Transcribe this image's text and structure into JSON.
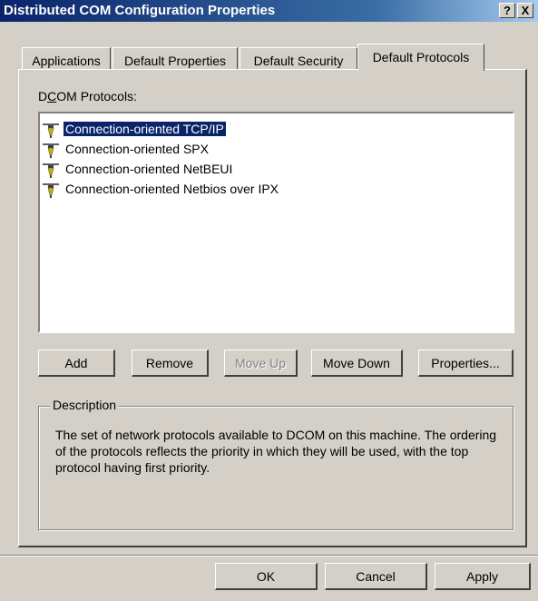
{
  "window": {
    "title": "Distributed COM Configuration Properties",
    "help_btn": "?",
    "close_btn": "X"
  },
  "tabs": [
    {
      "label": "Applications"
    },
    {
      "label": "Default Properties"
    },
    {
      "label": "Default Security"
    },
    {
      "label": "Default Protocols",
      "active": true
    }
  ],
  "protocols_label": "DCOM Protocols:",
  "protocols": [
    {
      "label": "Connection-oriented TCP/IP",
      "selected": true
    },
    {
      "label": "Connection-oriented SPX"
    },
    {
      "label": "Connection-oriented NetBEUI"
    },
    {
      "label": "Connection-oriented Netbios over IPX"
    }
  ],
  "buttons": {
    "add": "Add",
    "remove": "Remove",
    "move_up": "Move Up",
    "move_down": "Move Down",
    "properties": "Properties..."
  },
  "description": {
    "title": "Description",
    "text": "The set of network protocols available to DCOM on this machine. The ordering of the protocols reflects the priority in which they will be used, with the top protocol having first priority."
  },
  "footer": {
    "ok": "OK",
    "cancel": "Cancel",
    "apply": "Apply"
  }
}
